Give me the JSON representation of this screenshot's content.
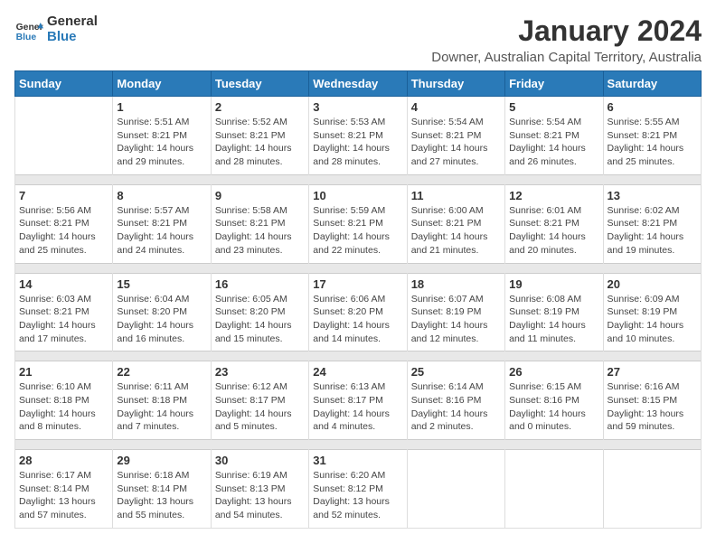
{
  "logo": {
    "text_general": "General",
    "text_blue": "Blue"
  },
  "title": "January 2024",
  "subtitle": "Downer, Australian Capital Territory, Australia",
  "header_color": "#2a7ab8",
  "weekdays": [
    "Sunday",
    "Monday",
    "Tuesday",
    "Wednesday",
    "Thursday",
    "Friday",
    "Saturday"
  ],
  "weeks": [
    [
      {
        "day": "",
        "info": ""
      },
      {
        "day": "1",
        "info": "Sunrise: 5:51 AM\nSunset: 8:21 PM\nDaylight: 14 hours\nand 29 minutes."
      },
      {
        "day": "2",
        "info": "Sunrise: 5:52 AM\nSunset: 8:21 PM\nDaylight: 14 hours\nand 28 minutes."
      },
      {
        "day": "3",
        "info": "Sunrise: 5:53 AM\nSunset: 8:21 PM\nDaylight: 14 hours\nand 28 minutes."
      },
      {
        "day": "4",
        "info": "Sunrise: 5:54 AM\nSunset: 8:21 PM\nDaylight: 14 hours\nand 27 minutes."
      },
      {
        "day": "5",
        "info": "Sunrise: 5:54 AM\nSunset: 8:21 PM\nDaylight: 14 hours\nand 26 minutes."
      },
      {
        "day": "6",
        "info": "Sunrise: 5:55 AM\nSunset: 8:21 PM\nDaylight: 14 hours\nand 25 minutes."
      }
    ],
    [
      {
        "day": "7",
        "info": "Sunrise: 5:56 AM\nSunset: 8:21 PM\nDaylight: 14 hours\nand 25 minutes."
      },
      {
        "day": "8",
        "info": "Sunrise: 5:57 AM\nSunset: 8:21 PM\nDaylight: 14 hours\nand 24 minutes."
      },
      {
        "day": "9",
        "info": "Sunrise: 5:58 AM\nSunset: 8:21 PM\nDaylight: 14 hours\nand 23 minutes."
      },
      {
        "day": "10",
        "info": "Sunrise: 5:59 AM\nSunset: 8:21 PM\nDaylight: 14 hours\nand 22 minutes."
      },
      {
        "day": "11",
        "info": "Sunrise: 6:00 AM\nSunset: 8:21 PM\nDaylight: 14 hours\nand 21 minutes."
      },
      {
        "day": "12",
        "info": "Sunrise: 6:01 AM\nSunset: 8:21 PM\nDaylight: 14 hours\nand 20 minutes."
      },
      {
        "day": "13",
        "info": "Sunrise: 6:02 AM\nSunset: 8:21 PM\nDaylight: 14 hours\nand 19 minutes."
      }
    ],
    [
      {
        "day": "14",
        "info": "Sunrise: 6:03 AM\nSunset: 8:21 PM\nDaylight: 14 hours\nand 17 minutes."
      },
      {
        "day": "15",
        "info": "Sunrise: 6:04 AM\nSunset: 8:20 PM\nDaylight: 14 hours\nand 16 minutes."
      },
      {
        "day": "16",
        "info": "Sunrise: 6:05 AM\nSunset: 8:20 PM\nDaylight: 14 hours\nand 15 minutes."
      },
      {
        "day": "17",
        "info": "Sunrise: 6:06 AM\nSunset: 8:20 PM\nDaylight: 14 hours\nand 14 minutes."
      },
      {
        "day": "18",
        "info": "Sunrise: 6:07 AM\nSunset: 8:19 PM\nDaylight: 14 hours\nand 12 minutes."
      },
      {
        "day": "19",
        "info": "Sunrise: 6:08 AM\nSunset: 8:19 PM\nDaylight: 14 hours\nand 11 minutes."
      },
      {
        "day": "20",
        "info": "Sunrise: 6:09 AM\nSunset: 8:19 PM\nDaylight: 14 hours\nand 10 minutes."
      }
    ],
    [
      {
        "day": "21",
        "info": "Sunrise: 6:10 AM\nSunset: 8:18 PM\nDaylight: 14 hours\nand 8 minutes."
      },
      {
        "day": "22",
        "info": "Sunrise: 6:11 AM\nSunset: 8:18 PM\nDaylight: 14 hours\nand 7 minutes."
      },
      {
        "day": "23",
        "info": "Sunrise: 6:12 AM\nSunset: 8:17 PM\nDaylight: 14 hours\nand 5 minutes."
      },
      {
        "day": "24",
        "info": "Sunrise: 6:13 AM\nSunset: 8:17 PM\nDaylight: 14 hours\nand 4 minutes."
      },
      {
        "day": "25",
        "info": "Sunrise: 6:14 AM\nSunset: 8:16 PM\nDaylight: 14 hours\nand 2 minutes."
      },
      {
        "day": "26",
        "info": "Sunrise: 6:15 AM\nSunset: 8:16 PM\nDaylight: 14 hours\nand 0 minutes."
      },
      {
        "day": "27",
        "info": "Sunrise: 6:16 AM\nSunset: 8:15 PM\nDaylight: 13 hours\nand 59 minutes."
      }
    ],
    [
      {
        "day": "28",
        "info": "Sunrise: 6:17 AM\nSunset: 8:14 PM\nDaylight: 13 hours\nand 57 minutes."
      },
      {
        "day": "29",
        "info": "Sunrise: 6:18 AM\nSunset: 8:14 PM\nDaylight: 13 hours\nand 55 minutes."
      },
      {
        "day": "30",
        "info": "Sunrise: 6:19 AM\nSunset: 8:13 PM\nDaylight: 13 hours\nand 54 minutes."
      },
      {
        "day": "31",
        "info": "Sunrise: 6:20 AM\nSunset: 8:12 PM\nDaylight: 13 hours\nand 52 minutes."
      },
      {
        "day": "",
        "info": ""
      },
      {
        "day": "",
        "info": ""
      },
      {
        "day": "",
        "info": ""
      }
    ]
  ]
}
